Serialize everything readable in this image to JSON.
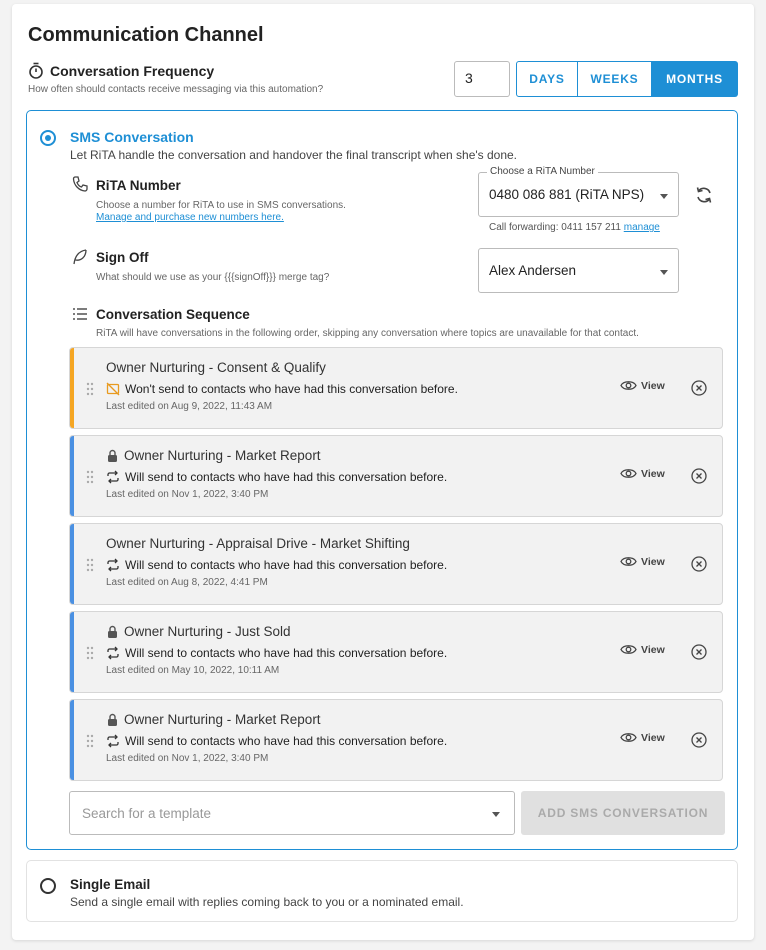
{
  "header": {
    "title": "Communication Channel"
  },
  "frequency": {
    "label": "Conversation Frequency",
    "description": "How often should contacts receive messaging via this automation?",
    "value": "3",
    "units": [
      {
        "label": "DAYS",
        "active": false
      },
      {
        "label": "WEEKS",
        "active": false
      },
      {
        "label": "MONTHS",
        "active": true
      }
    ]
  },
  "sms": {
    "title": "SMS Conversation",
    "description": "Let RiTA handle the conversation and handover the final transcript when she's done.",
    "selected": true,
    "rita_number": {
      "label": "RiTA Number",
      "description": "Choose a number for RiTA to use in SMS conversations.",
      "link": "Manage and purchase new numbers here.",
      "select_legend": "Choose a RiTA Number",
      "select_value": "0480 086 881 (RiTA NPS)",
      "call_forwarding_prefix": "Call forwarding: 0411 157 211",
      "call_forwarding_link": "manage"
    },
    "sign_off": {
      "label": "Sign Off",
      "description": "What should we use as your {{{signOff}}} merge tag?",
      "select_value": "Alex Andersen"
    },
    "sequence": {
      "label": "Conversation Sequence",
      "description": "RiTA will have conversations in the following order, skipping any conversation where topics are unavailable for that contact.",
      "view_label": "View",
      "items": [
        {
          "name": "Owner Nurturing - Consent & Qualify",
          "locked": false,
          "sub": "Won't send to contacts who have had this conversation before.",
          "repeat": false,
          "edited": "Last edited on Aug 9, 2022, 11:43 AM",
          "accent": "#f5a623"
        },
        {
          "name": "Owner Nurturing - Market Report",
          "locked": true,
          "sub": "Will send to contacts who have had this conversation before.",
          "repeat": true,
          "edited": "Last edited on Nov 1, 2022, 3:40 PM",
          "accent": "#4a90e2"
        },
        {
          "name": "Owner Nurturing - Appraisal Drive - Market Shifting",
          "locked": false,
          "sub": "Will send to contacts who have had this conversation before.",
          "repeat": true,
          "edited": "Last edited on Aug 8, 2022, 4:41 PM",
          "accent": "#4a90e2"
        },
        {
          "name": "Owner Nurturing - Just Sold",
          "locked": true,
          "sub": "Will send to contacts who have had this conversation before.",
          "repeat": true,
          "edited": "Last edited on May 10, 2022, 10:11 AM",
          "accent": "#4a90e2"
        },
        {
          "name": "Owner Nurturing - Market Report",
          "locked": true,
          "sub": "Will send to contacts who have had this conversation before.",
          "repeat": true,
          "edited": "Last edited on Nov 1, 2022, 3:40 PM",
          "accent": "#4a90e2"
        }
      ]
    },
    "search_placeholder": "Search for a template",
    "add_button": "ADD SMS CONVERSATION"
  },
  "email": {
    "title": "Single Email",
    "description": "Send a single email with replies coming back to you or a nominated email.",
    "selected": false
  }
}
